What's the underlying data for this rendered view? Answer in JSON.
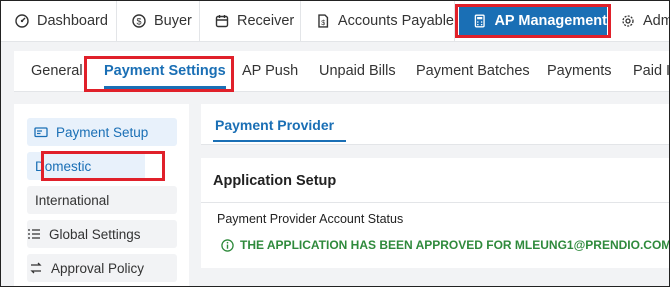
{
  "top_tabs": [
    {
      "label": "Dashboard",
      "icon": "dashboard-icon"
    },
    {
      "label": "Buyer",
      "icon": "dollar-circle-icon"
    },
    {
      "label": "Receiver",
      "icon": "calendar-icon"
    },
    {
      "label": "Accounts Payable",
      "icon": "document-dollar-icon"
    },
    {
      "label": "AP Management",
      "icon": "calculator-icon",
      "active": true
    },
    {
      "label": "Adm",
      "icon": "gear-icon"
    }
  ],
  "sub_tabs": [
    {
      "label": "General"
    },
    {
      "label": "Payment Settings",
      "active": true
    },
    {
      "label": "AP Push"
    },
    {
      "label": "Unpaid Bills"
    },
    {
      "label": "Payment Batches"
    },
    {
      "label": "Payments"
    },
    {
      "label": "Paid I"
    }
  ],
  "sidebar": {
    "items": [
      {
        "label": "Payment Setup",
        "icon": "card-setup-icon",
        "selected": true
      },
      {
        "label": "Domestic",
        "selected": true
      },
      {
        "label": "International"
      },
      {
        "label": "Global Settings",
        "icon": "list-settings-icon"
      },
      {
        "label": "Approval Policy",
        "icon": "approval-policy-icon"
      }
    ]
  },
  "panel": {
    "tab": "Payment Provider",
    "card_title": "Application Setup",
    "status_label": "Payment Provider Account Status",
    "status_message": "THE APPLICATION HAS BEEN APPROVED FOR MLEUNG1@PRENDIO.COM",
    "status_icon": "info-circle-icon"
  },
  "colors": {
    "accent": "#1a6fb5",
    "highlight_box": "#e0202a",
    "success": "#2f8a3c",
    "background": "#f2f3f5"
  }
}
